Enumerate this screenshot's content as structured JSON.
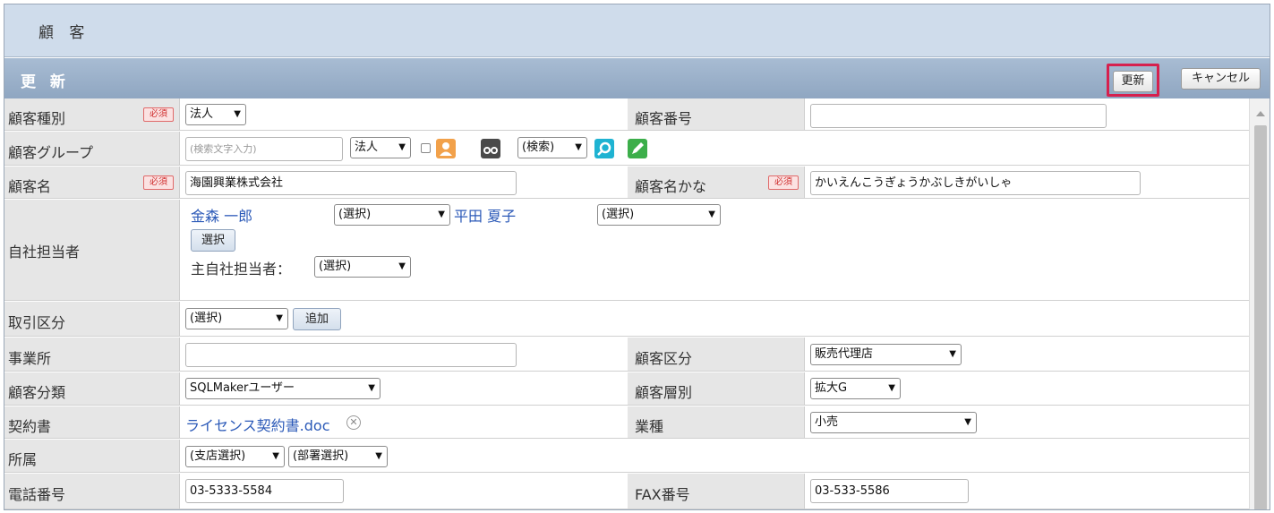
{
  "title": "顧 客",
  "subtitle": "更 新",
  "buttons": {
    "update": "更新",
    "cancel": "キャンセル"
  },
  "required_badge": "必須",
  "rows": {
    "customer_type": {
      "label": "顧客種別",
      "value": "法人"
    },
    "customer_number": {
      "label": "顧客番号",
      "value": ""
    },
    "customer_group": {
      "label": "顧客グループ",
      "search_placeholder": "(検索文字入力)",
      "type": "法人",
      "search_select": "(検索)"
    },
    "customer_name": {
      "label": "顧客名",
      "value": "海園興業株式会社"
    },
    "customer_kana": {
      "label": "顧客名かな",
      "value": "かいえんこうぎょうかぶしきがいしゃ"
    },
    "staff": {
      "label": "自社担当者",
      "staff1": "金森 一郎",
      "staff1_select": "(選択)",
      "staff2": "平田 夏子",
      "staff2_select": "(選択)",
      "select_button": "選択",
      "main_label": "主自社担当者：",
      "main_select": "(選択)"
    },
    "transaction": {
      "label": "取引区分",
      "select": "(選択)",
      "add_button": "追加"
    },
    "office": {
      "label": "事業所",
      "value": ""
    },
    "customer_category": {
      "label": "顧客区分",
      "value": "販売代理店"
    },
    "customer_class": {
      "label": "顧客分類",
      "value": "SQLMakerユーザー"
    },
    "customer_tier": {
      "label": "顧客層別",
      "value": "拡大G"
    },
    "contract": {
      "label": "契約書",
      "file": "ライセンス契約書.doc"
    },
    "industry": {
      "label": "業種",
      "value": "小売"
    },
    "affiliation": {
      "label": "所属",
      "branch": "(支店選択)",
      "dept": "(部署選択)"
    },
    "phone": {
      "label": "電話番号",
      "value": "03-5333-5584"
    },
    "fax": {
      "label": "FAX番号",
      "value": "03-533-5586"
    }
  },
  "colors": {
    "required": "#d03030",
    "link": "#2c5ab8",
    "highlight": "#d6204e",
    "header": "#8fa6c1"
  }
}
